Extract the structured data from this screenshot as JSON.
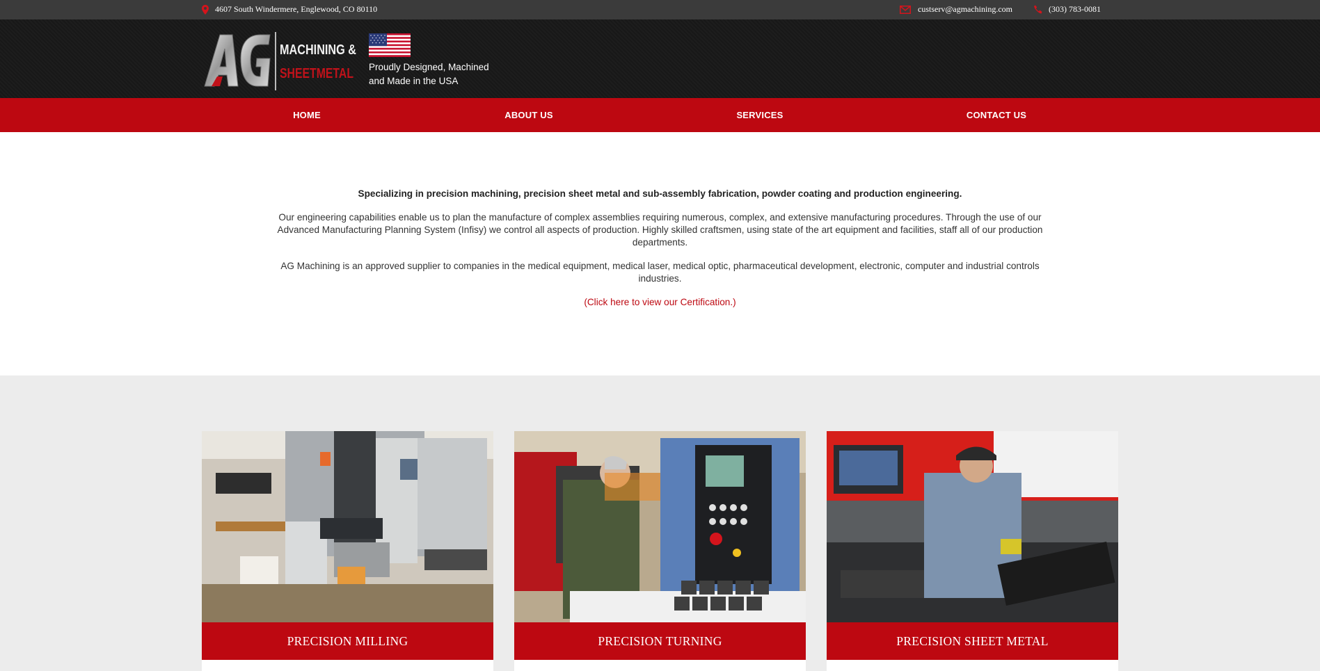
{
  "topbar": {
    "address": "4607 South Windermere, Englewood, CO 80110",
    "email": "custserv@agmachining.com",
    "phone": "(303) 783-0081"
  },
  "header": {
    "logo_text_main": "AG",
    "logo_text_line1": "MACHINING &",
    "logo_text_line2": "SHEETMETAL",
    "tagline_line1": "Proudly Designed, Machined",
    "tagline_line2": "and Made in the USA"
  },
  "nav": {
    "items": [
      {
        "label": "HOME"
      },
      {
        "label": "ABOUT US"
      },
      {
        "label": "SERVICES"
      },
      {
        "label": "CONTACT US"
      }
    ]
  },
  "intro": {
    "lead": "Specializing in precision machining, precision sheet metal and sub-assembly fabrication, powder coating and production engineering.",
    "paragraph1": "Our engineering capabilities enable us to plan the manufacture of complex assemblies requiring numerous, complex, and extensive manufacturing procedures. Through the use of our Advanced Manufacturing Planning System (Infisy) we control all aspects of production. Highly skilled craftsmen, using state of the art equipment and facilities, staff all of our production departments.",
    "paragraph2": "AG Machining is an approved supplier to companies in the medical equipment, medical laser, medical optic, pharmaceutical development, electronic, computer and industrial controls industries.",
    "cert_open": "(",
    "cert_link": "Click here to view our Certification.",
    "cert_close": ")"
  },
  "cards": [
    {
      "label": "PRECISION MILLING"
    },
    {
      "label": "PRECISION TURNING"
    },
    {
      "label": "PRECISION SHEET METAL"
    }
  ],
  "colors": {
    "brand_red": "#bd0811",
    "topbar_bg": "#3b3b3b",
    "header_bg": "#1b1b1b"
  }
}
